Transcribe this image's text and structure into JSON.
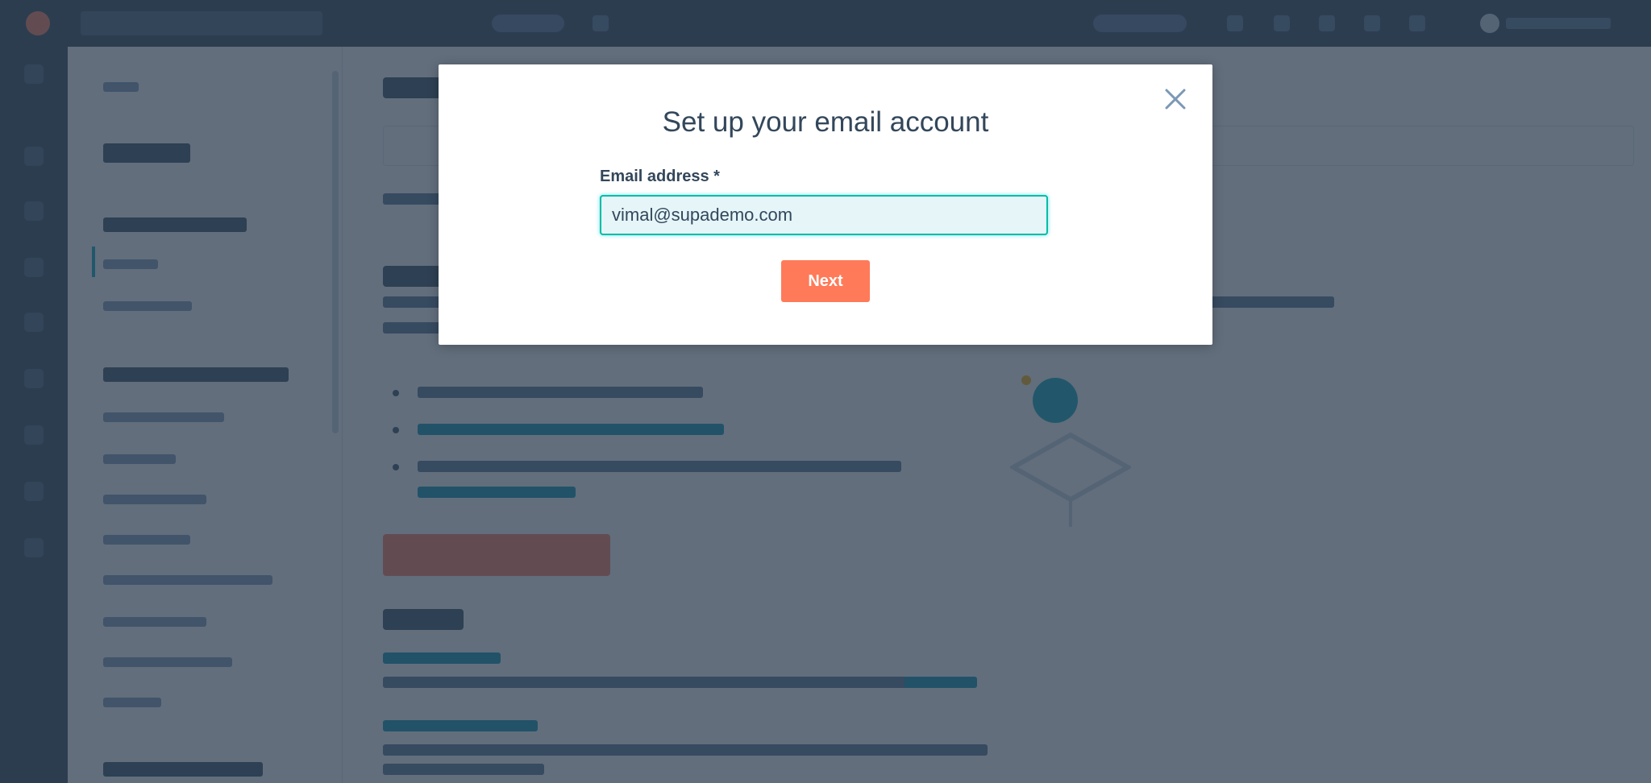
{
  "modal": {
    "title": "Set up your email account",
    "email_label": "Email address *",
    "email_value": "vimal@supademo.com",
    "next_label": "Next",
    "close_icon": "close-icon"
  },
  "colors": {
    "accent": "#ff7a59",
    "focus": "#00bda5",
    "text": "#33475b",
    "nav": "#2d3e50"
  }
}
